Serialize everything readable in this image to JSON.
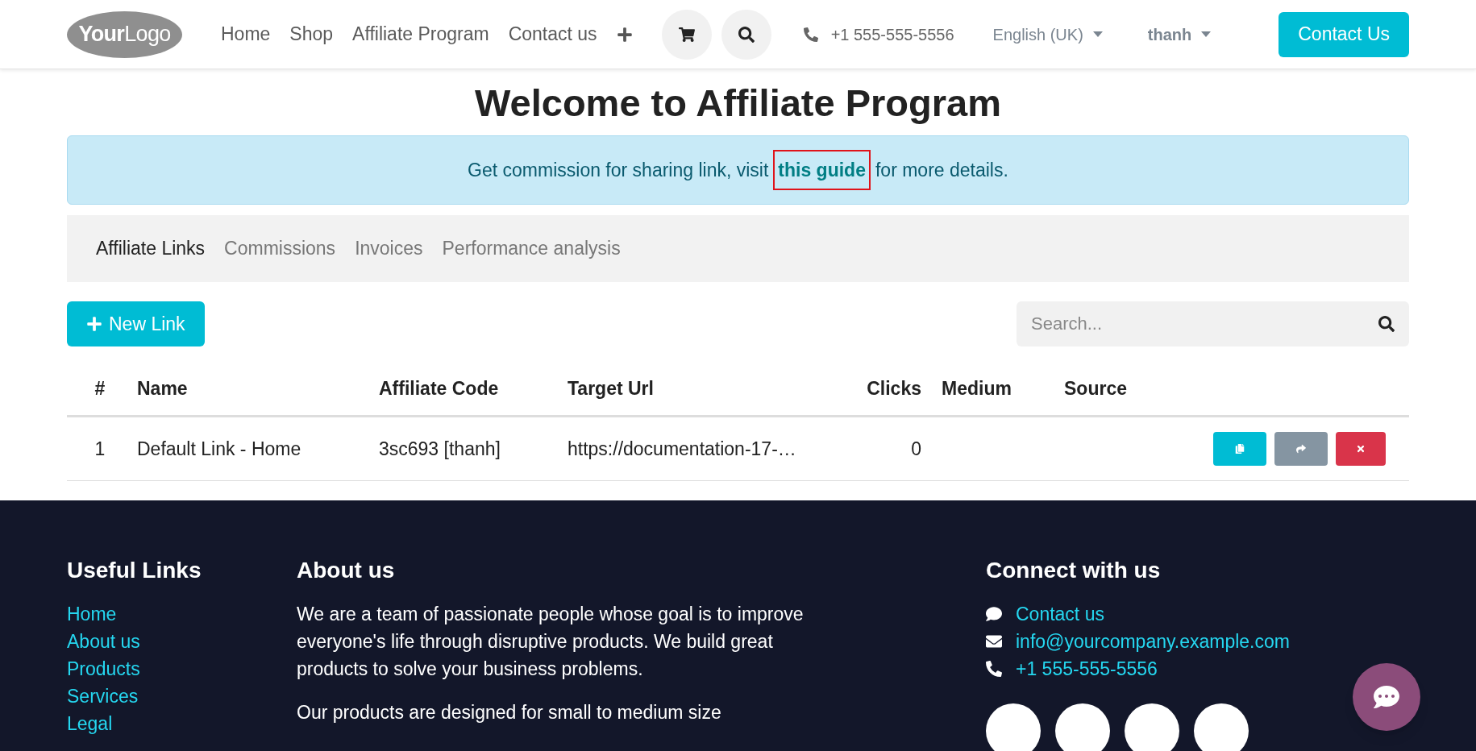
{
  "header": {
    "logo": {
      "bold": "Your",
      "light": "Logo"
    },
    "nav": [
      {
        "label": "Home",
        "selected": false
      },
      {
        "label": "Shop",
        "selected": false
      },
      {
        "label": "Affiliate Program",
        "selected": false
      },
      {
        "label": "Contact us",
        "selected": false
      }
    ],
    "phone": "+1 555-555-5556",
    "language": "English (UK)",
    "user": "thanh",
    "cta": "Contact Us"
  },
  "title": "Welcome to Affiliate Program",
  "banner": {
    "before": "Get commission for sharing link, visit",
    "link": "this guide",
    "after": "for more details.",
    "link_highlighted": true
  },
  "tabs": [
    {
      "label": "Affiliate Links",
      "selected": true
    },
    {
      "label": "Commissions",
      "selected": false
    },
    {
      "label": "Invoices",
      "selected": false
    },
    {
      "label": "Performance analysis",
      "selected": false
    }
  ],
  "new_button": "New Link",
  "search": {
    "placeholder": "Search..."
  },
  "table": {
    "columns": [
      "#",
      "Name",
      "Affiliate Code",
      "Target Url",
      "Clicks",
      "Medium",
      "Source"
    ],
    "rows": [
      {
        "cells": [
          "1",
          "Default Link - Home",
          "3sc693 [thanh]",
          "https://documentation-17-…",
          "0",
          "",
          ""
        ]
      }
    ]
  },
  "footer": {
    "links_title": "Useful Links",
    "links": [
      "Home",
      "About us",
      "Products",
      "Services",
      "Legal"
    ],
    "about_title": "About us",
    "about": [
      "We are a team of passionate people whose goal is to improve everyone's life through disruptive products. We build great products to solve your business problems.",
      "Our products are designed for small to medium size"
    ],
    "connect_title": "Connect with us",
    "contacts": [
      {
        "kind": "chat",
        "label": "Contact us"
      },
      {
        "kind": "mail",
        "label": "info@yourcompany.example.com"
      },
      {
        "kind": "phone",
        "label": "+1 555-555-5556"
      }
    ]
  }
}
